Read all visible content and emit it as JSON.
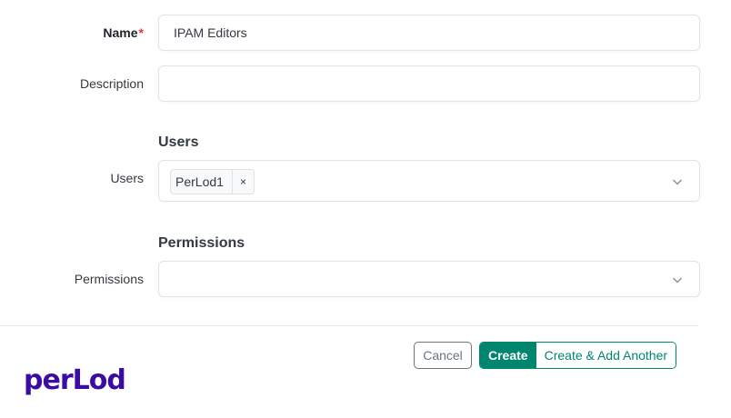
{
  "form": {
    "name": {
      "label": "Name",
      "required_mark": "*",
      "value": "IPAM Editors"
    },
    "description": {
      "label": "Description",
      "value": ""
    },
    "users_section": {
      "title": "Users",
      "label": "Users",
      "tags": [
        {
          "text": "PerLod1",
          "remove": "×"
        }
      ]
    },
    "permissions_section": {
      "title": "Permissions",
      "label": "Permissions"
    }
  },
  "actions": {
    "cancel": "Cancel",
    "create": "Create",
    "create_another": "Create & Add Another"
  },
  "logo": {
    "text": "perLod"
  },
  "colors": {
    "primary": "#00856f",
    "required": "#dc3545",
    "logo": "#3a0ca3"
  }
}
